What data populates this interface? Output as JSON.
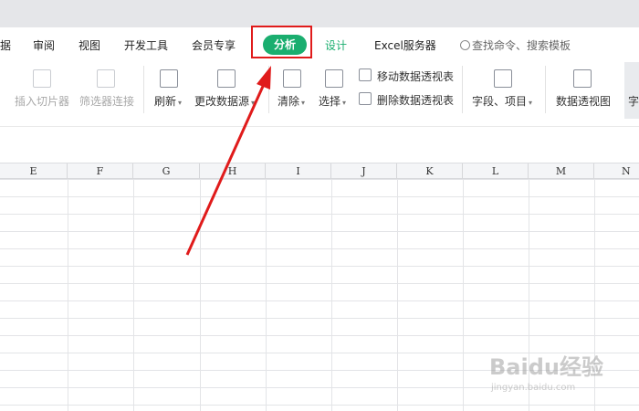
{
  "menu": {
    "items": [
      "据",
      "审阅",
      "视图",
      "开发工具",
      "会员专享"
    ],
    "active": "分析",
    "design": "设计",
    "excel": "Excel服务器",
    "search": "查找命令、搜索模板"
  },
  "toolbar": {
    "insert_slicer": "插入切片器",
    "filter_conn": "筛选器连接",
    "refresh": "刷新",
    "change_source": "更改数据源",
    "clear": "清除",
    "select": "选择",
    "move_pivot": "移动数据透视表",
    "delete_pivot": "删除数据透视表",
    "field_item": "字段、项目",
    "pivot_chart": "数据透视图",
    "right_tab": "字"
  },
  "columns": [
    "E",
    "F",
    "G",
    "H",
    "I",
    "J",
    "K",
    "L",
    "M",
    "N"
  ],
  "colors": {
    "accent": "#1aae6f",
    "highlight": "#e01b1b"
  },
  "watermark": {
    "brand": "Baidu经验",
    "site": "jingyan.baidu.com"
  }
}
